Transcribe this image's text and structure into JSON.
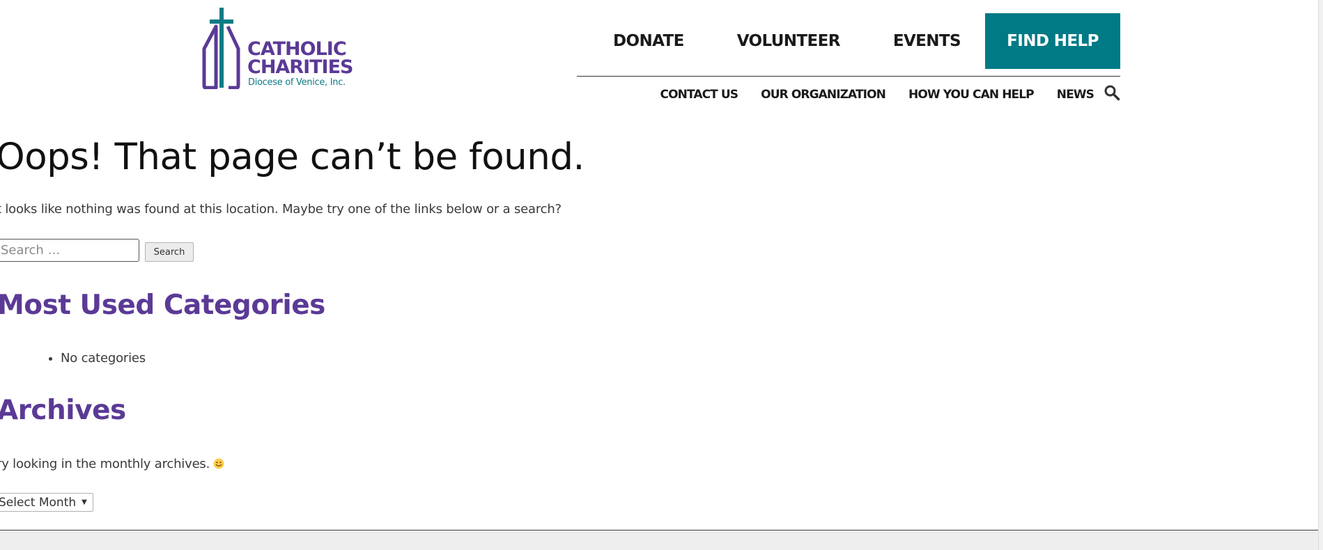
{
  "logo": {
    "line1": "CATHOLIC",
    "line2": "CHARITIES",
    "line3": "Diocese of Venice, Inc.",
    "colors": {
      "purple": "#5b3a96",
      "teal": "#0e7b85"
    },
    "icon": "cross-church-icon"
  },
  "nav": {
    "primary": [
      {
        "label": "DONATE"
      },
      {
        "label": "VOLUNTEER"
      },
      {
        "label": "EVENTS"
      }
    ],
    "cta": {
      "label": "FIND HELP",
      "color": "#007a85"
    },
    "secondary": [
      {
        "label": "CONTACT US"
      },
      {
        "label": "OUR ORGANIZATION"
      },
      {
        "label": "HOW YOU CAN HELP"
      },
      {
        "label": "NEWS"
      }
    ],
    "search_icon": "search-icon"
  },
  "content": {
    "title": "Oops! That page can’t be found.",
    "intro": "t looks like nothing was found at this location. Maybe try one of the links below or a search?",
    "search": {
      "placeholder": "Search …",
      "value": "",
      "button_label": "Search"
    },
    "categories": {
      "heading": "Most Used Categories",
      "items": [
        "No categories"
      ]
    },
    "archives": {
      "heading": "Archives",
      "text": "ry looking in the monthly archives.",
      "emoji_icon": "smiley-icon",
      "select": {
        "selected": "Select Month"
      }
    }
  },
  "colors": {
    "heading_purple": "#5b3a96",
    "cta_teal": "#007a85"
  }
}
